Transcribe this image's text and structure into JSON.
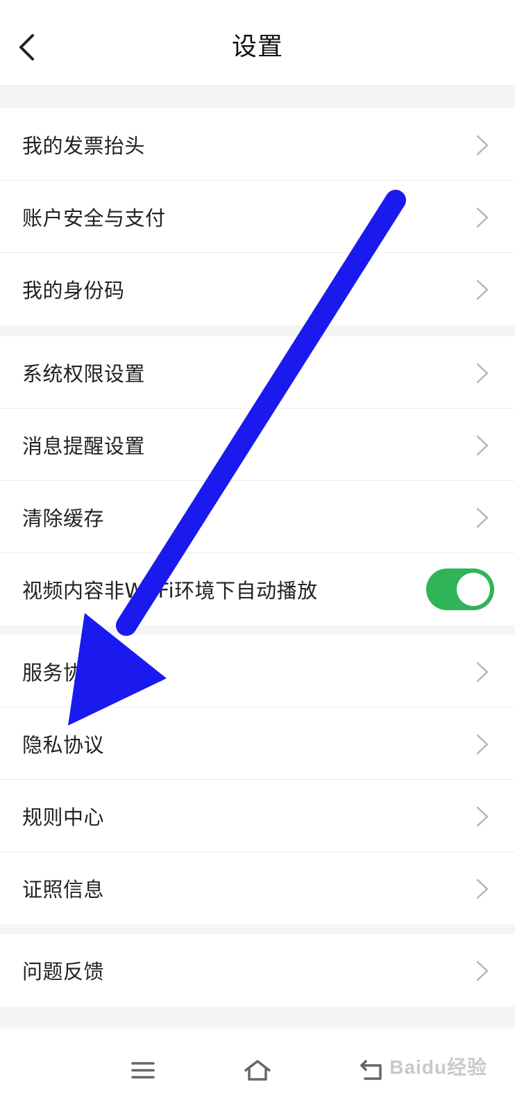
{
  "header": {
    "title": "设置"
  },
  "groups": [
    {
      "items": [
        {
          "label": "我的发票抬头"
        },
        {
          "label": "账户安全与支付"
        },
        {
          "label": "我的身份码"
        }
      ]
    },
    {
      "items": [
        {
          "label": "系统权限设置"
        },
        {
          "label": "消息提醒设置"
        },
        {
          "label": "清除缓存"
        },
        {
          "label": "视频内容非Wi-Fi环境下自动播放",
          "toggle": true
        }
      ]
    },
    {
      "items": [
        {
          "label": "服务协议"
        },
        {
          "label": "隐私协议"
        },
        {
          "label": "规则中心"
        },
        {
          "label": "证照信息"
        }
      ]
    },
    {
      "items": [
        {
          "label": "问题反馈"
        }
      ]
    }
  ],
  "colors": {
    "toggle_on": "#2fb457",
    "annotation_arrow": "#1a1aee"
  },
  "icons": {
    "back": "chevron-left-icon",
    "row": "chevron-right-icon",
    "nav": [
      "menu-icon",
      "home-icon",
      "back-icon"
    ]
  },
  "watermark": "Baidu经验"
}
